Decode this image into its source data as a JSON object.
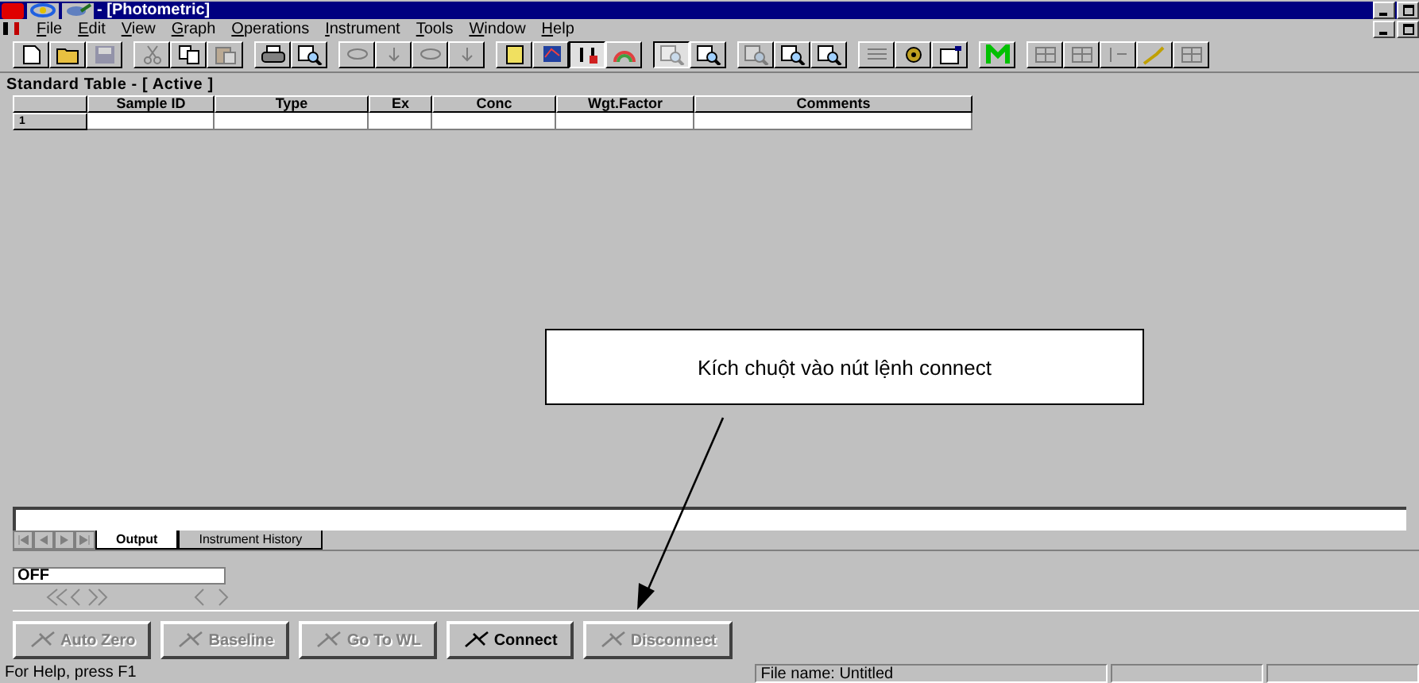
{
  "window": {
    "title": "- [Photometric]"
  },
  "menu": [
    "File",
    "Edit",
    "View",
    "Graph",
    "Operations",
    "Instrument",
    "Tools",
    "Window",
    "Help"
  ],
  "toolbar": [
    [
      {
        "disabled": false,
        "pressed": false
      },
      {
        "disabled": false,
        "pressed": false
      },
      {
        "disabled": true,
        "pressed": false
      }
    ],
    [
      {
        "disabled": true,
        "pressed": false
      },
      {
        "disabled": false,
        "pressed": false
      },
      {
        "disabled": true,
        "pressed": false
      }
    ],
    [
      {
        "disabled": false,
        "pressed": false
      },
      {
        "disabled": false,
        "pressed": false
      }
    ],
    [
      {
        "disabled": true,
        "pressed": false
      },
      {
        "disabled": true,
        "pressed": false
      },
      {
        "disabled": true,
        "pressed": false
      },
      {
        "disabled": true,
        "pressed": false
      }
    ],
    [
      {
        "disabled": false,
        "pressed": false
      },
      {
        "disabled": false,
        "pressed": false
      },
      {
        "disabled": false,
        "pressed": true
      },
      {
        "disabled": false,
        "pressed": false
      }
    ],
    [
      {
        "disabled": true,
        "pressed": true
      },
      {
        "disabled": false,
        "pressed": false
      }
    ],
    [
      {
        "disabled": true,
        "pressed": false
      },
      {
        "disabled": false,
        "pressed": false
      },
      {
        "disabled": false,
        "pressed": false
      }
    ],
    [
      {
        "disabled": true,
        "pressed": false
      },
      {
        "disabled": false,
        "pressed": false
      },
      {
        "disabled": false,
        "pressed": false
      }
    ],
    [
      {
        "disabled": false,
        "pressed": false
      }
    ],
    [
      {
        "disabled": true,
        "pressed": false
      },
      {
        "disabled": true,
        "pressed": false
      },
      {
        "disabled": true,
        "pressed": false
      },
      {
        "disabled": false,
        "pressed": false
      },
      {
        "disabled": true,
        "pressed": false
      }
    ]
  ],
  "panel_title": "Standard Table - [ Active ]",
  "table": {
    "columns": [
      "Sample ID",
      "Type",
      "Ex",
      "Conc",
      "Wgt.Factor",
      "Comments"
    ],
    "rows": [
      {
        "index": "1",
        "cells": [
          "",
          "",
          "",
          "",
          "",
          ""
        ]
      }
    ]
  },
  "callout": {
    "text": "Kích chuột vào nút lệnh connect"
  },
  "tabs": [
    {
      "label": "Output",
      "selected": true
    },
    {
      "label": "Instrument History",
      "selected": false
    }
  ],
  "status_field": {
    "value": "OFF"
  },
  "buttons": [
    {
      "label": "Auto Zero",
      "disabled": true
    },
    {
      "label": "Baseline",
      "disabled": true
    },
    {
      "label": "Go To WL",
      "disabled": true
    },
    {
      "label": "Connect",
      "disabled": false
    },
    {
      "label": "Disconnect",
      "disabled": true
    }
  ],
  "status_bar": [
    "For Help, press F1",
    "File name: Untitled"
  ]
}
